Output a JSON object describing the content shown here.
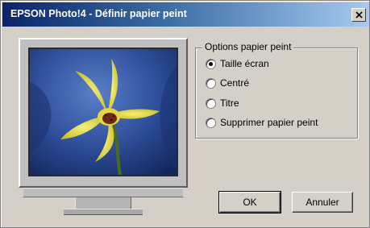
{
  "window": {
    "title": "EPSON Photo!4 - Définir papier peint",
    "close_glyph": "✕"
  },
  "options": {
    "legend": "Options papier peint",
    "items": [
      {
        "label": "Taille écran",
        "selected": true
      },
      {
        "label": "Centré",
        "selected": false
      },
      {
        "label": "Titre",
        "selected": false
      },
      {
        "label": "Supprimer papier peint",
        "selected": false
      }
    ]
  },
  "buttons": {
    "ok": "OK",
    "cancel": "Annuler"
  },
  "preview": {
    "subject": "yellow-flower-wallpaper",
    "colors": {
      "background": "#2d4d99",
      "petal": "#e9e24a",
      "center": "#6b2a1a"
    }
  }
}
